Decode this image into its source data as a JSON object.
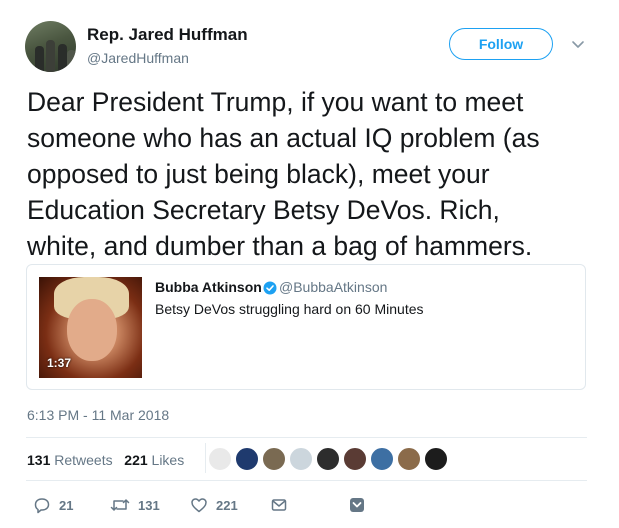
{
  "author": {
    "name": "Rep. Jared Huffman",
    "handle": "@JaredHuffman",
    "avatar_icon": "profile-photo",
    "follow_label": "Follow"
  },
  "tweet": {
    "lines": [
      "Dear President Trump, if you want to meet",
      "someone who has an actual IQ problem (as",
      "opposed to just being black), meet your",
      "Education Secretary Betsy DeVos.  Rich,",
      "white, and dumber than a bag of hammers."
    ],
    "timestamp": "6:13 PM - 11 Mar 2018"
  },
  "quoted": {
    "name": "Bubba Atkinson",
    "handle": "@BubbaAtkinson",
    "text": "Betsy DeVos struggling hard on 60 Minutes",
    "video_duration": "1:37",
    "verified": true
  },
  "stats": {
    "retweets_count": "131",
    "retweets_label": "Retweets",
    "likes_count": "221",
    "likes_label": "Likes"
  },
  "actions": {
    "reply_count": "21",
    "retweet_count": "131",
    "like_count": "221"
  },
  "colors": {
    "accent": "#1da1f2",
    "secondary_text": "#657786",
    "border": "#e6ecf0"
  }
}
